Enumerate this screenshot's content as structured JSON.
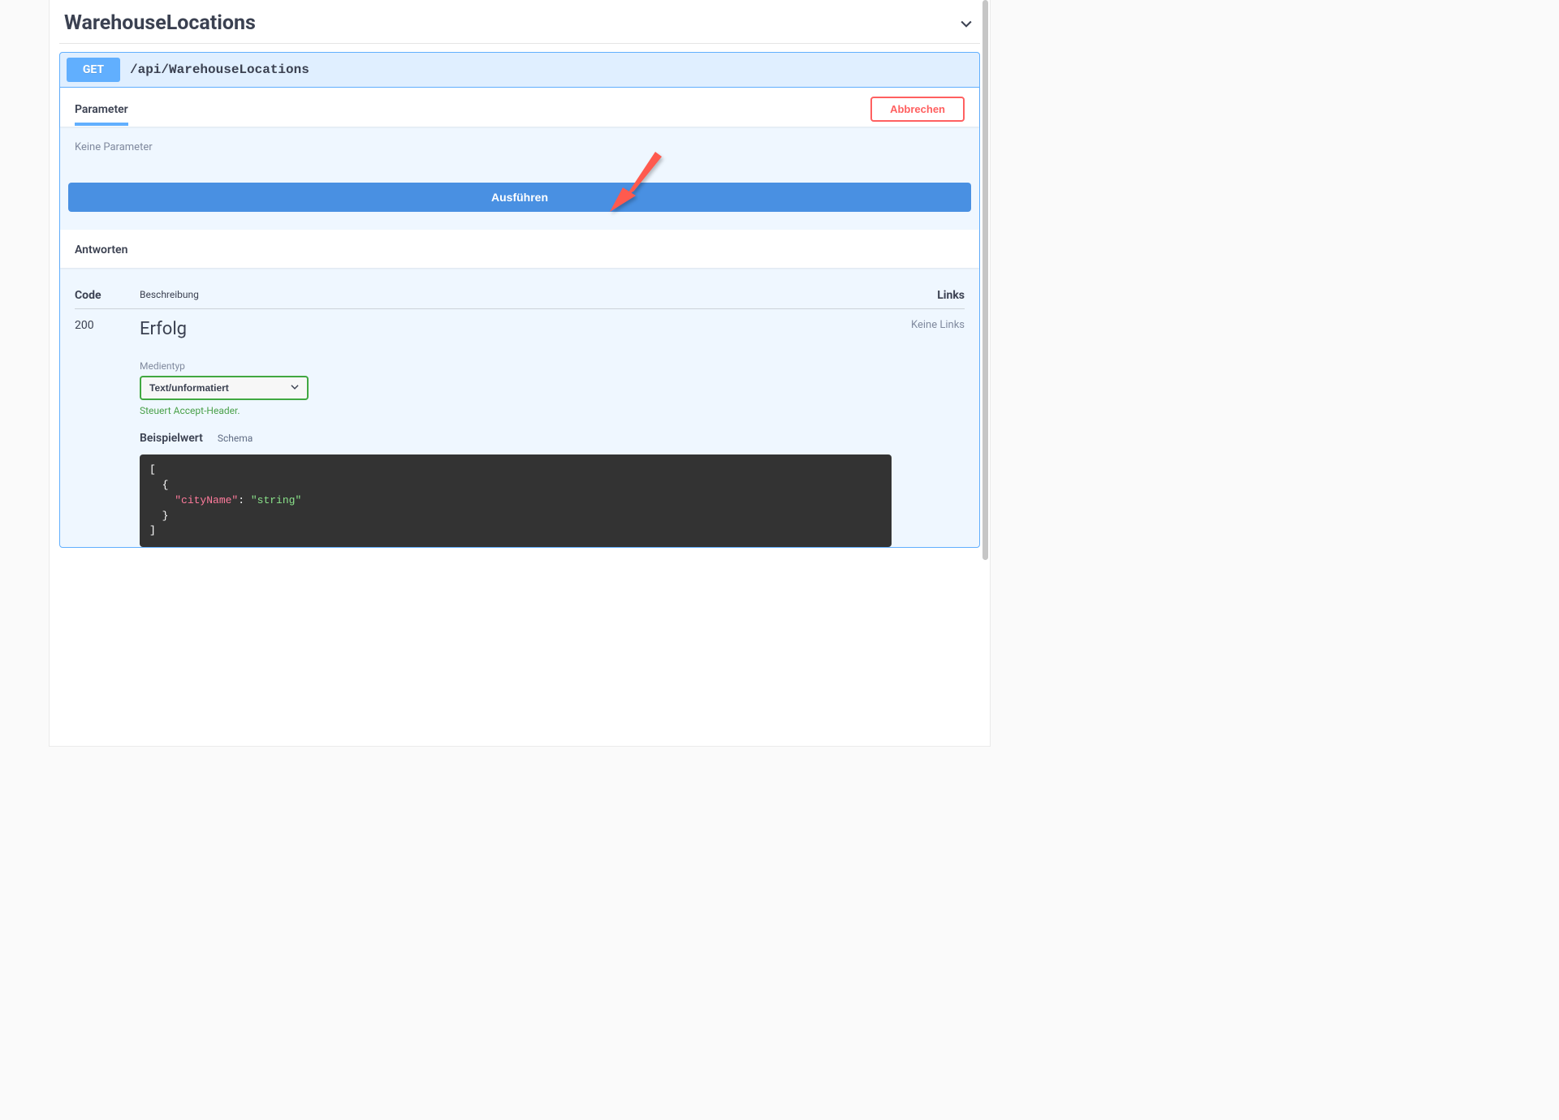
{
  "tag": {
    "title": "WarehouseLocations"
  },
  "op": {
    "method": "GET",
    "path": "/api/WarehouseLocations",
    "parameter_tab": "Parameter",
    "cancel": "Abbrechen",
    "no_params": "Keine Parameter",
    "execute": "Ausführen",
    "responses_heading": "Antworten"
  },
  "responses": {
    "head": {
      "code": "Code",
      "desc": "Beschreibung",
      "links": "Links"
    },
    "row": {
      "code": "200",
      "links": "Keine Links",
      "desc": "Erfolg",
      "media_label": "Medientyp",
      "media_value": "Text/unformatiert",
      "accept_note": "Steuert Accept-Header.",
      "tab_example": "Beispielwert",
      "tab_schema": "Schema",
      "example_key": "\"cityName\"",
      "example_val": "\"string\""
    }
  }
}
